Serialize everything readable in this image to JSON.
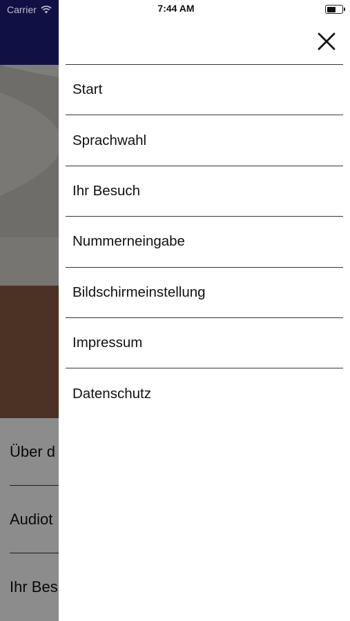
{
  "status_bar": {
    "carrier": "Carrier",
    "time": "7:44 AM",
    "wifi_icon": "wifi-icon",
    "battery_icon": "battery-icon"
  },
  "colors": {
    "header_background": "#201e7e",
    "drawer_background": "#ffffff",
    "divider": "#333333",
    "overlay": "rgba(0,0,0,0.45)"
  },
  "drawer": {
    "close_icon": "close-icon",
    "menu": [
      {
        "label": "Start"
      },
      {
        "label": "Sprachwahl"
      },
      {
        "label": "Ihr Besuch"
      },
      {
        "label": "Nummerneingabe"
      },
      {
        "label": "Bildschirmeinstellung"
      },
      {
        "label": "Impressum"
      },
      {
        "label": "Datenschutz"
      }
    ]
  },
  "background": {
    "items": [
      {
        "label": "Über d"
      },
      {
        "label": "Audiot"
      },
      {
        "label": "Ihr Bes"
      }
    ]
  }
}
